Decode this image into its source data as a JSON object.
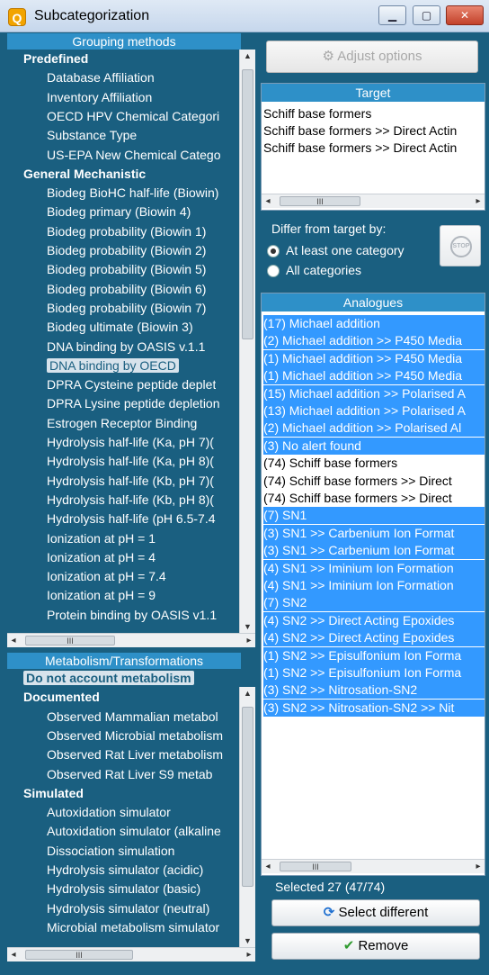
{
  "window": {
    "title": "Subcategorization",
    "app_icon": "Q"
  },
  "grouping": {
    "header": "Grouping methods",
    "items": [
      {
        "label": "Predefined",
        "level": 0
      },
      {
        "label": "Database Affiliation",
        "level": 1
      },
      {
        "label": "Inventory Affiliation",
        "level": 1
      },
      {
        "label": "OECD HPV Chemical Categori",
        "level": 1
      },
      {
        "label": "Substance Type",
        "level": 1
      },
      {
        "label": "US-EPA New Chemical Catego",
        "level": 1
      },
      {
        "label": "General Mechanistic",
        "level": 0
      },
      {
        "label": "Biodeg BioHC half-life (Biowin)",
        "level": 1
      },
      {
        "label": "Biodeg primary (Biowin 4)",
        "level": 1
      },
      {
        "label": "Biodeg probability (Biowin 1)",
        "level": 1
      },
      {
        "label": "Biodeg probability (Biowin 2)",
        "level": 1
      },
      {
        "label": "Biodeg probability (Biowin 5)",
        "level": 1
      },
      {
        "label": "Biodeg probability (Biowin 6)",
        "level": 1
      },
      {
        "label": "Biodeg probability (Biowin 7)",
        "level": 1
      },
      {
        "label": "Biodeg ultimate (Biowin 3)",
        "level": 1
      },
      {
        "label": "DNA binding by OASIS v.1.1",
        "level": 1
      },
      {
        "label": "DNA binding by OECD",
        "level": 1,
        "selected": true
      },
      {
        "label": "DPRA Cysteine peptide deplet",
        "level": 1
      },
      {
        "label": "DPRA Lysine peptide depletion",
        "level": 1
      },
      {
        "label": "Estrogen Receptor Binding",
        "level": 1
      },
      {
        "label": "Hydrolysis half-life (Ka, pH 7)(",
        "level": 1
      },
      {
        "label": "Hydrolysis half-life (Ka, pH 8)(",
        "level": 1
      },
      {
        "label": "Hydrolysis half-life (Kb, pH 7)(",
        "level": 1
      },
      {
        "label": "Hydrolysis half-life (Kb, pH 8)(",
        "level": 1
      },
      {
        "label": "Hydrolysis half-life (pH 6.5-7.4",
        "level": 1
      },
      {
        "label": "Ionization at pH = 1",
        "level": 1
      },
      {
        "label": "Ionization at pH = 4",
        "level": 1
      },
      {
        "label": "Ionization at pH = 7.4",
        "level": 1
      },
      {
        "label": "Ionization at pH = 9",
        "level": 1
      },
      {
        "label": "Protein binding by OASIS v1.1",
        "level": 1
      }
    ]
  },
  "metabolism": {
    "header": "Metabolism/Transformations",
    "items": [
      {
        "label": "Do not account metabolism",
        "level": 0,
        "selected": true
      },
      {
        "label": "Documented",
        "level": 0
      },
      {
        "label": "Observed Mammalian metabol",
        "level": 1
      },
      {
        "label": "Observed Microbial metabolism",
        "level": 1
      },
      {
        "label": "Observed Rat Liver metabolism",
        "level": 1
      },
      {
        "label": "Observed Rat Liver S9 metab",
        "level": 1
      },
      {
        "label": "Simulated",
        "level": 0
      },
      {
        "label": "Autoxidation simulator",
        "level": 1
      },
      {
        "label": "Autoxidation simulator (alkaline",
        "level": 1
      },
      {
        "label": "Dissociation simulation",
        "level": 1
      },
      {
        "label": "Hydrolysis simulator (acidic)",
        "level": 1
      },
      {
        "label": "Hydrolysis simulator (basic)",
        "level": 1
      },
      {
        "label": "Hydrolysis simulator (neutral)",
        "level": 1
      },
      {
        "label": "Microbial metabolism simulator",
        "level": 1
      }
    ]
  },
  "adjust_button": {
    "label": "Adjust options",
    "icon": "settings-icon"
  },
  "target": {
    "header": "Target",
    "lines": [
      "Schiff base formers",
      "Schiff base formers >> Direct Actin",
      "Schiff base formers >> Direct Actin"
    ]
  },
  "differ": {
    "label": "Differ from target by:",
    "options": [
      {
        "label": "At least one category",
        "checked": true
      },
      {
        "label": "All categories",
        "checked": false
      }
    ],
    "stop_label": "STOP"
  },
  "analogues": {
    "header": "Analogues",
    "lines": [
      {
        "text": "(17) Michael addition",
        "hl": true
      },
      {
        "text": "(2) Michael addition >> P450 Media",
        "hl": true
      },
      {
        "text": "(1) Michael addition >> P450 Media",
        "hl": true
      },
      {
        "text": "(1) Michael addition >> P450 Media",
        "hl": true
      },
      {
        "text": "(15) Michael addition >> Polarised A",
        "hl": true
      },
      {
        "text": "(13) Michael addition >> Polarised A",
        "hl": true
      },
      {
        "text": "(2) Michael addition >> Polarised Al",
        "hl": true
      },
      {
        "text": "(3) No alert found",
        "hl": true
      },
      {
        "text": "(74) Schiff base formers",
        "hl": false
      },
      {
        "text": "(74) Schiff base formers >> Direct",
        "hl": false
      },
      {
        "text": "(74) Schiff base formers >> Direct",
        "hl": false
      },
      {
        "text": "(7) SN1",
        "hl": true
      },
      {
        "text": "(3) SN1 >> Carbenium Ion Format",
        "hl": true
      },
      {
        "text": "(3) SN1 >> Carbenium Ion Format",
        "hl": true
      },
      {
        "text": "(4) SN1 >> Iminium Ion Formation",
        "hl": true
      },
      {
        "text": "(4) SN1 >> Iminium Ion Formation",
        "hl": true
      },
      {
        "text": "(7) SN2",
        "hl": true
      },
      {
        "text": "(4) SN2 >> Direct Acting Epoxides",
        "hl": true
      },
      {
        "text": "(4) SN2 >> Direct Acting Epoxides",
        "hl": true
      },
      {
        "text": "(1) SN2 >> Episulfonium Ion Forma",
        "hl": true
      },
      {
        "text": "(1) SN2 >> Episulfonium Ion Forma",
        "hl": true
      },
      {
        "text": "(3) SN2 >> Nitrosation-SN2",
        "hl": true
      },
      {
        "text": "(3) SN2 >> Nitrosation-SN2 >> Nit",
        "hl": true
      }
    ],
    "selected_text": "Selected 27 (47/74)"
  },
  "select_button": {
    "label": "Select different",
    "icon": "refresh-icon"
  },
  "remove_button": {
    "label": "Remove",
    "icon": "checkmark-icon"
  },
  "colors": {
    "panel_bg": "#1a5f80",
    "header_bg": "#2e90c8",
    "highlight": "#3399ff"
  }
}
